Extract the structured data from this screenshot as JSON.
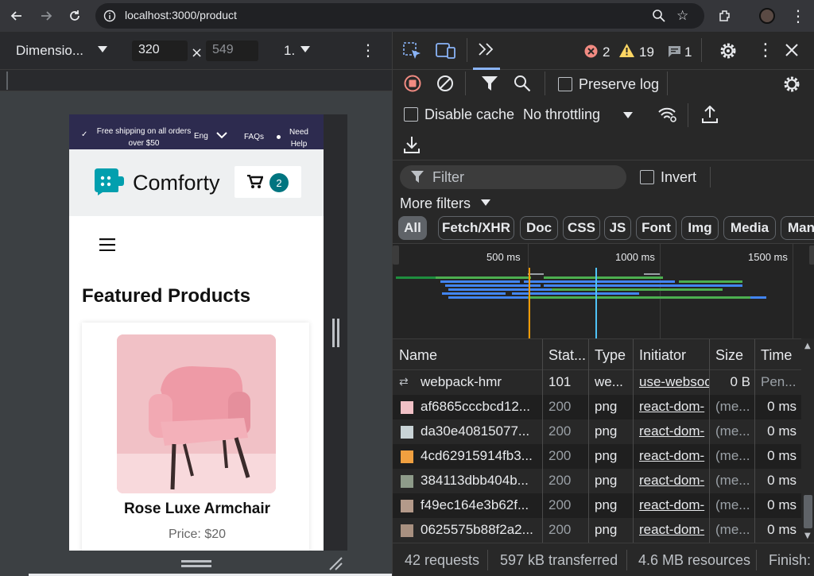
{
  "browser": {
    "url": "localhost:3000/product"
  },
  "device_toolbar": {
    "dimension_label": "Dimensio...",
    "width": "320",
    "height_placeholder": "549",
    "zoom": "1."
  },
  "site": {
    "topbar": {
      "shipping": "Free shipping on all orders over $50",
      "lang": "Eng",
      "faqs": "FAQs",
      "help": "Need Help"
    },
    "brand": "Comforty",
    "cart_count": "2",
    "section_title": "Featured Products",
    "product": {
      "name": "Rose Luxe Armchair",
      "price": "Price: $20"
    }
  },
  "devtools": {
    "errors": "2",
    "warnings": "19",
    "messages": "1",
    "preserve_log": "Preserve log",
    "disable_cache": "Disable cache",
    "throttling": "No throttling",
    "filter_placeholder": "Filter",
    "invert": "Invert",
    "more_filters": "More filters",
    "filter_chips": [
      "All",
      "Fetch/XHR",
      "Doc",
      "CSS",
      "JS",
      "Font",
      "Img",
      "Media",
      "Man"
    ],
    "timeline_ticks": [
      "500 ms",
      "1000 ms",
      "1500 ms"
    ],
    "columns": [
      "Name",
      "Stat...",
      "Type",
      "Initiator",
      "Size",
      "Time"
    ],
    "rows": [
      {
        "name": "webpack-hmr",
        "status": "101",
        "type": "we...",
        "initiator": "use-websoc",
        "size": "0 B",
        "time": "Pen..."
      },
      {
        "name": "af6865cccbcd12...",
        "status": "200",
        "type": "png",
        "initiator": "react-dom-",
        "size": "(me...",
        "time": "0 ms"
      },
      {
        "name": "da30e40815077...",
        "status": "200",
        "type": "png",
        "initiator": "react-dom-",
        "size": "(me...",
        "time": "0 ms"
      },
      {
        "name": "4cd62915914fb3...",
        "status": "200",
        "type": "png",
        "initiator": "react-dom-",
        "size": "(me...",
        "time": "0 ms"
      },
      {
        "name": "384113dbb404b...",
        "status": "200",
        "type": "png",
        "initiator": "react-dom-",
        "size": "(me...",
        "time": "0 ms"
      },
      {
        "name": "f49ec164e3b62f...",
        "status": "200",
        "type": "png",
        "initiator": "react-dom-",
        "size": "(me...",
        "time": "0 ms"
      },
      {
        "name": "0625575b88f2a2...",
        "status": "200",
        "type": "png",
        "initiator": "react-dom-",
        "size": "(me...",
        "time": "0 ms"
      }
    ],
    "status": {
      "requests": "42 requests",
      "transferred": "597 kB transferred",
      "resources": "4.6 MB resources",
      "finish": "Finish:"
    }
  }
}
